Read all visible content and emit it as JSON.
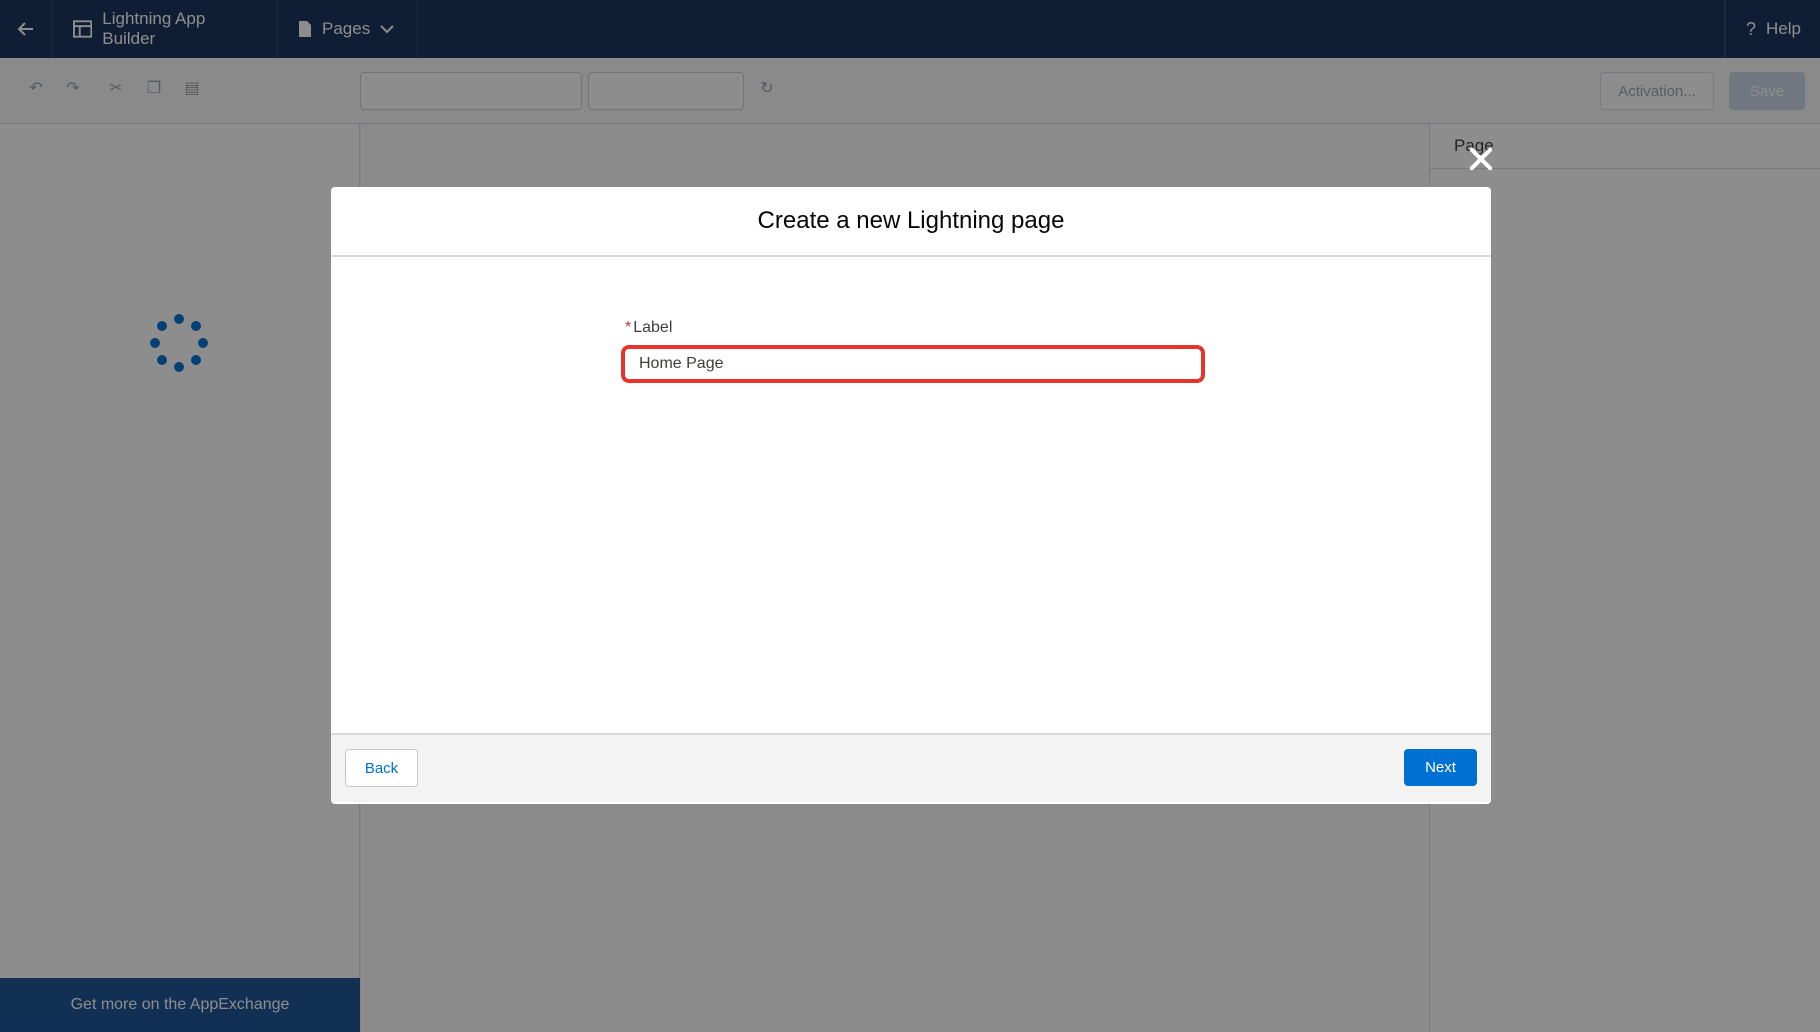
{
  "topbar": {
    "app_name": "Lightning App Builder",
    "pages_label": "Pages",
    "help_label": "Help"
  },
  "toolbar": {
    "activation_label": "Activation...",
    "save_label": "Save"
  },
  "left_panel": {
    "appexchange_label": "Get more on the AppExchange"
  },
  "right_panel": {
    "title": "Page"
  },
  "modal": {
    "title": "Create a new Lightning page",
    "field": {
      "required_marker": "*",
      "label": "Label",
      "value": "Home Page"
    },
    "back_label": "Back",
    "next_label": "Next"
  },
  "colors": {
    "brand_blue": "#0070d2",
    "header_navy": "#16325c",
    "highlight_red": "#e5342b"
  }
}
